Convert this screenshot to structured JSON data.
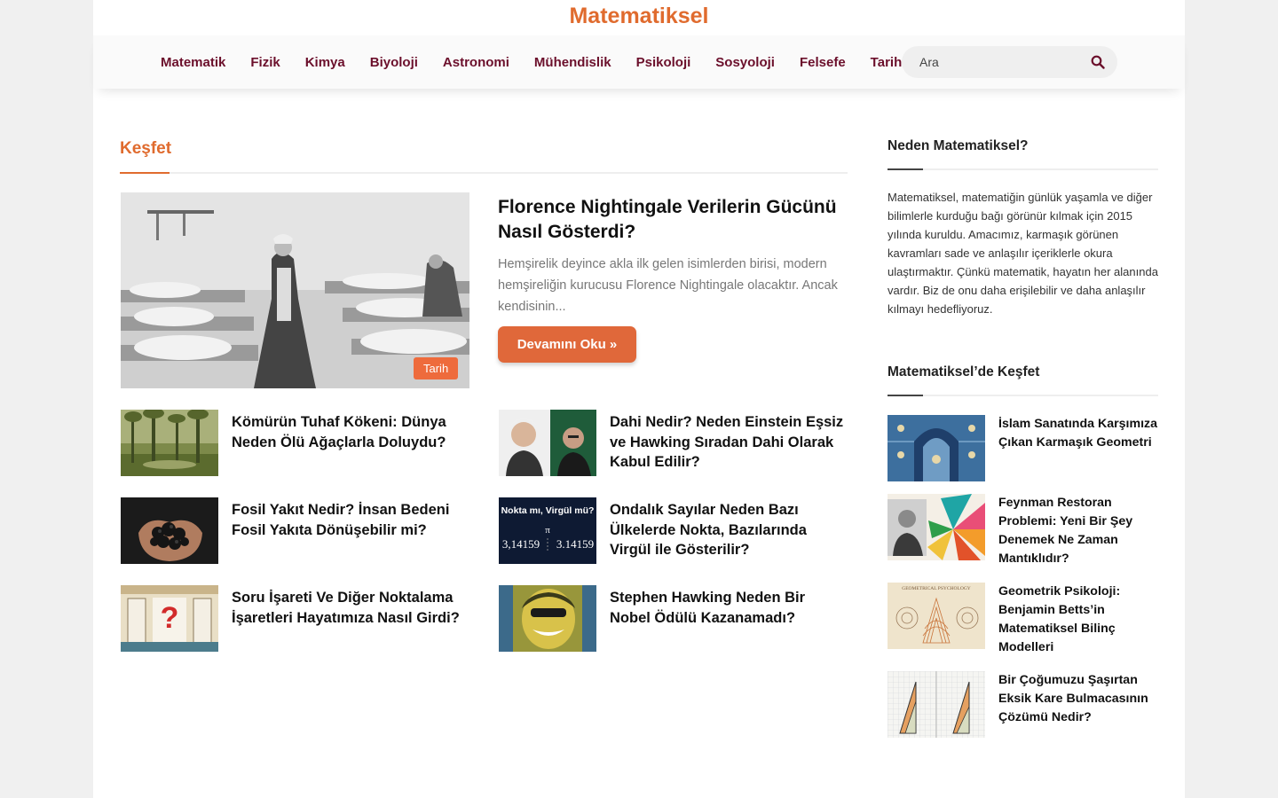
{
  "site": {
    "title": "Matematiksel"
  },
  "nav": {
    "items": [
      "Matematik",
      "Fizik",
      "Kimya",
      "Biyoloji",
      "Astronomi",
      "Mühendislik",
      "Psikoloji",
      "Sosyoloji",
      "Felsefe",
      "Tarih"
    ]
  },
  "search": {
    "placeholder": "Ara",
    "icon": "search-icon"
  },
  "main": {
    "section_title": "Keşfet",
    "featured": {
      "title": "Florence Nightingale Verilerin Gücünü Nasıl Gösterdi?",
      "excerpt": "Hemşirelik deyince akla ilk gelen isimlerden birisi, modern hemşireliğin kurucusu Florence Nightingale olacaktır. Ancak kendisinin...",
      "category": "Tarih",
      "read_more": "Devamını Oku »"
    },
    "posts": [
      {
        "title": "Kömürün Tuhaf Kökeni: Dünya Neden Ölü Ağaçlarla Doluydu?"
      },
      {
        "title": "Dahi Nedir? Neden Einstein Eşsiz ve Hawking Sıradan Dahi Olarak Kabul Edilir?"
      },
      {
        "title": "Fosil Yakıt Nedir? İnsan Bedeni Fosil Yakıta Dönüşebilir mi?"
      },
      {
        "title": "Ondalık Sayılar Neden Bazı Ülkelerde Nokta, Bazılarında Virgül ile Gösterilir?",
        "thumb_text": {
          "heading": "Nokta mı, Virgül mü?",
          "pi": "π",
          "left": "3,14159",
          "right": "3.14159"
        }
      },
      {
        "title": "Soru İşareti Ve Diğer Noktalama İşaretleri Hayatımıza Nasıl Girdi?",
        "thumb_text": {
          "mark": "?"
        }
      },
      {
        "title": "Stephen Hawking Neden Bir Nobel Ödülü Kazanamadı?"
      }
    ]
  },
  "sidebar": {
    "about_title": "Neden Matematiksel?",
    "about_text": "Matematiksel, matematiğin günlük yaşamla ve diğer bilimlerle kurduğu bağı görünür kılmak için 2015 yılında kuruldu. Amacımız, karmaşık görünen kavramları sade ve anlaşılır içeriklerle okura ulaştırmaktır. Çünkü matematik, hayatın her alanında vardır. Biz de onu daha erişilebilir ve daha anlaşılır kılmayı hedefliyoruz.",
    "explore_title": "Matematiksel’de Keşfet",
    "posts": [
      {
        "title": "İslam Sanatında Karşımıza Çıkan Karmaşık Geometri"
      },
      {
        "title": "Feynman Restoran Problemi: Yeni Bir Şey Denemek Ne Zaman Mantıklıdır?"
      },
      {
        "title": "Geometrik Psikoloji: Benjamin Betts’in Matematiksel Bilinç Modelleri",
        "thumb_text": {
          "heading": "GEOMETRICAL PSYCHOLOGY"
        }
      },
      {
        "title": "Bir Çoğumuzu Şaşırtan Eksik Kare Bulmacasının Çözümü Nedir?"
      }
    ]
  },
  "colors": {
    "accent": "#e06b2e",
    "nav_text": "#6b0f2b",
    "button": "#e0683a"
  }
}
